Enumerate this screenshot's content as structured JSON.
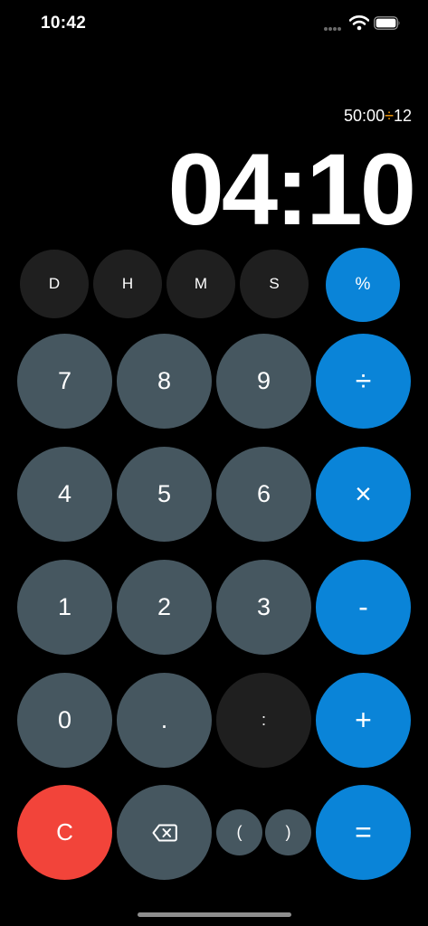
{
  "status": {
    "time": "10:42",
    "icons": [
      "signal-dots-icon",
      "wifi-icon",
      "battery-icon"
    ]
  },
  "display": {
    "expression_left": "50:00",
    "expression_operator": "÷",
    "expression_right": "12",
    "result": "04:10"
  },
  "units": {
    "days": "D",
    "hours": "H",
    "minutes": "M",
    "seconds": "S"
  },
  "keys": {
    "percent": "%",
    "seven": "7",
    "eight": "8",
    "nine": "9",
    "divide": "÷",
    "four": "4",
    "five": "5",
    "six": "6",
    "multiply": "×",
    "one": "1",
    "two": "2",
    "three": "3",
    "subtract": "-",
    "zero": "0",
    "decimal": ".",
    "colon": ":",
    "add": "+",
    "clear": "C",
    "backspace_icon": "backspace-icon",
    "paren_open": "(",
    "paren_close": ")",
    "equals": "="
  },
  "colors": {
    "background": "#000000",
    "number_key": "#465760",
    "dark_key": "#1f1f1f",
    "operator_key": "#0a84d8",
    "clear_key": "#f2443a",
    "operator_text": "#ff9f0a"
  }
}
